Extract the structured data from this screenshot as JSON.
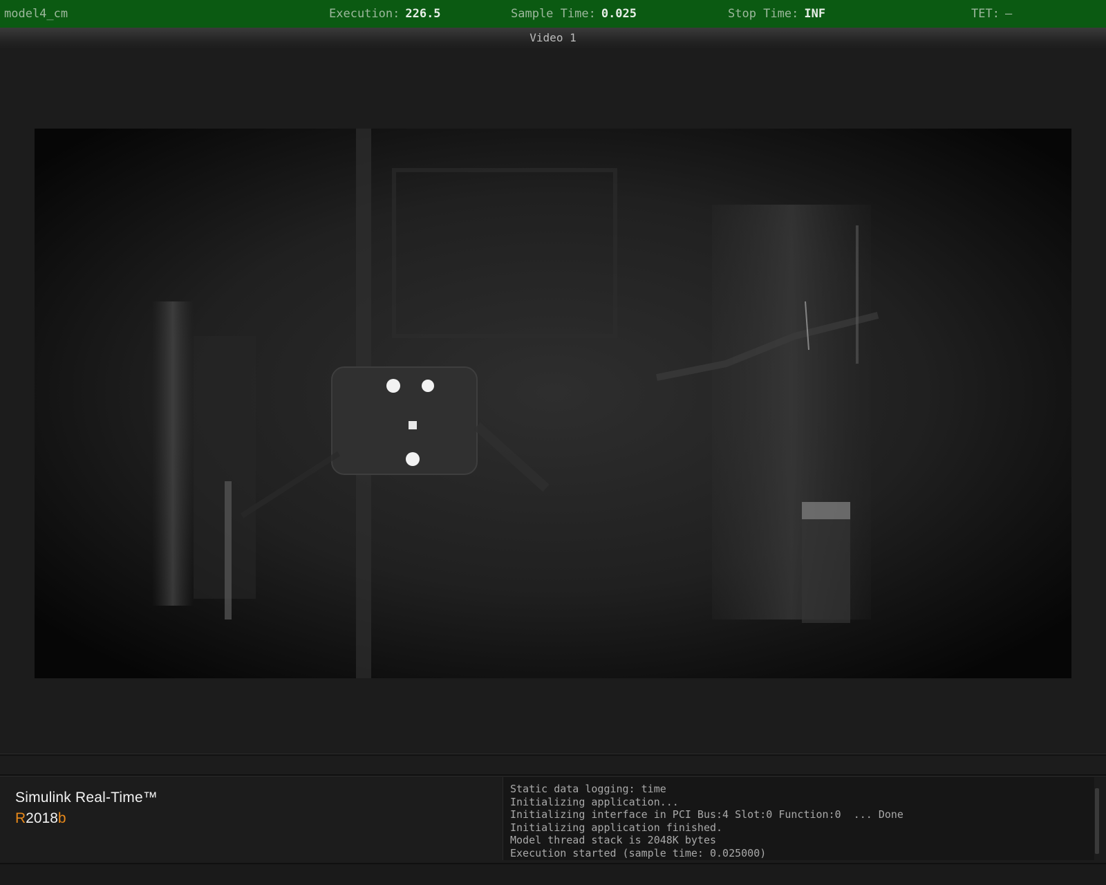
{
  "topbar": {
    "model_name": "model4_cm",
    "execution_label": "Execution:",
    "execution_value": "226.5",
    "sample_time_label": "Sample Time:",
    "sample_time_value": "0.025",
    "stop_time_label": "Stop Time:",
    "stop_time_value": "INF",
    "tet_label": "TET:",
    "tet_value": "–",
    "background_color": "#0b5a12"
  },
  "video": {
    "title": "Video 1"
  },
  "brand": {
    "product": "Simulink Real-Time™",
    "release_prefix": "R",
    "release_year": "2018",
    "release_suffix": "b",
    "accent_color": "#e8891a"
  },
  "log": {
    "lines": [
      "Static data logging: time",
      "Initializing application...",
      "Initializing interface in PCI Bus:4 Slot:0 Function:0  ... Done",
      "Initializing application finished.",
      "Model thread stack is 2048K bytes",
      "Execution started (sample time: 0.025000)"
    ]
  }
}
